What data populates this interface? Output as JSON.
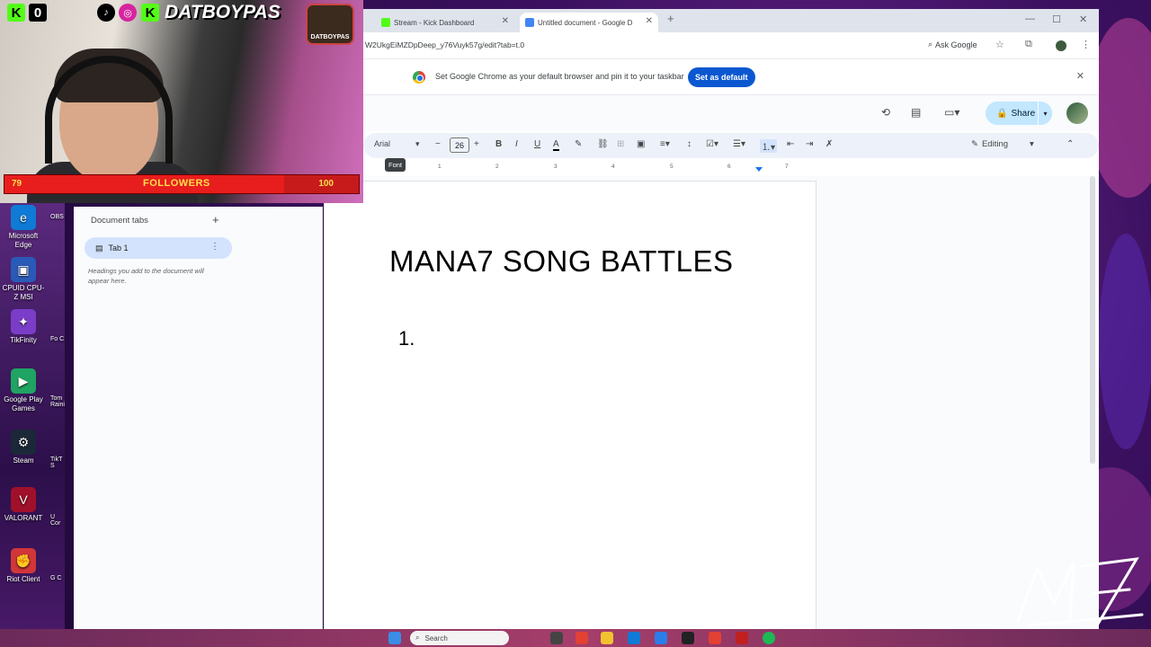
{
  "stream_overlay": {
    "handle": "DATBOYPAS",
    "kick_logo": "K",
    "kick_logo_2": "K",
    "stream_logo_text": "DATBOYPAS",
    "followers": {
      "label": "FOLLOWERS",
      "current": "79",
      "goal": "100",
      "progress": 0.79
    }
  },
  "desktop_icons": [
    {
      "label": "Microsoft Edge",
      "icon": "edge-icon",
      "color": "#0f7bd6"
    },
    {
      "label": "CPUID CPU-Z MSI",
      "icon": "cpuz-icon",
      "color": "#2a5ab8"
    },
    {
      "label": "TikFinity",
      "icon": "tikfinity-icon",
      "color": "#7a3dc8"
    },
    {
      "label": "Google Play Games",
      "icon": "play-games-icon",
      "color": "#1fa463"
    },
    {
      "label": "Steam",
      "icon": "steam-icon",
      "color": "#1b2838"
    },
    {
      "label": "VALORANT",
      "icon": "valorant-icon",
      "color": "#a0102a"
    },
    {
      "label": "Riot Client",
      "icon": "riot-icon",
      "color": "#d13639"
    }
  ],
  "desktop_side_labels": [
    "OBS",
    "Fo C",
    "Tom Raini",
    "TikT S",
    "U Cor",
    "G C"
  ],
  "browser": {
    "tabs": [
      {
        "label": "Stream - Kick Dashboard",
        "favicon_color": "#53fc18",
        "active": false
      },
      {
        "label": "Untitled document - Google D",
        "favicon_color": "#4285f4",
        "active": true
      }
    ],
    "new_tab": "+",
    "url": "W2UkgEiMZDpDeep_y76Vuyk57g/edit?tab=t.0",
    "ask_google": "Ask Google",
    "infobar": {
      "message": "Set Google Chrome as your default browser and pin it to your taskbar",
      "button": "Set as default"
    }
  },
  "docs": {
    "share_label": "Share",
    "toolbar": {
      "font": "Arial",
      "font_size": "26",
      "mode": "Editing",
      "tooltip": "Font"
    },
    "ruler": [
      "1",
      "2",
      "3",
      "4",
      "5",
      "6",
      "7"
    ],
    "tabs_panel": {
      "title": "Document tabs",
      "tab_label": "Tab 1",
      "hint": "Headings you add to the document will appear here."
    },
    "document": {
      "title": "MANA7 SONG BATTLES",
      "list_first": "1."
    }
  },
  "taskbar": {
    "search_placeholder": "Search"
  },
  "colors": {
    "accent_blue": "#0b57d0",
    "share_bg": "#c2e7ff",
    "tab_highlight": "#d3e3fd",
    "follower_bar": "#c71a1a"
  }
}
